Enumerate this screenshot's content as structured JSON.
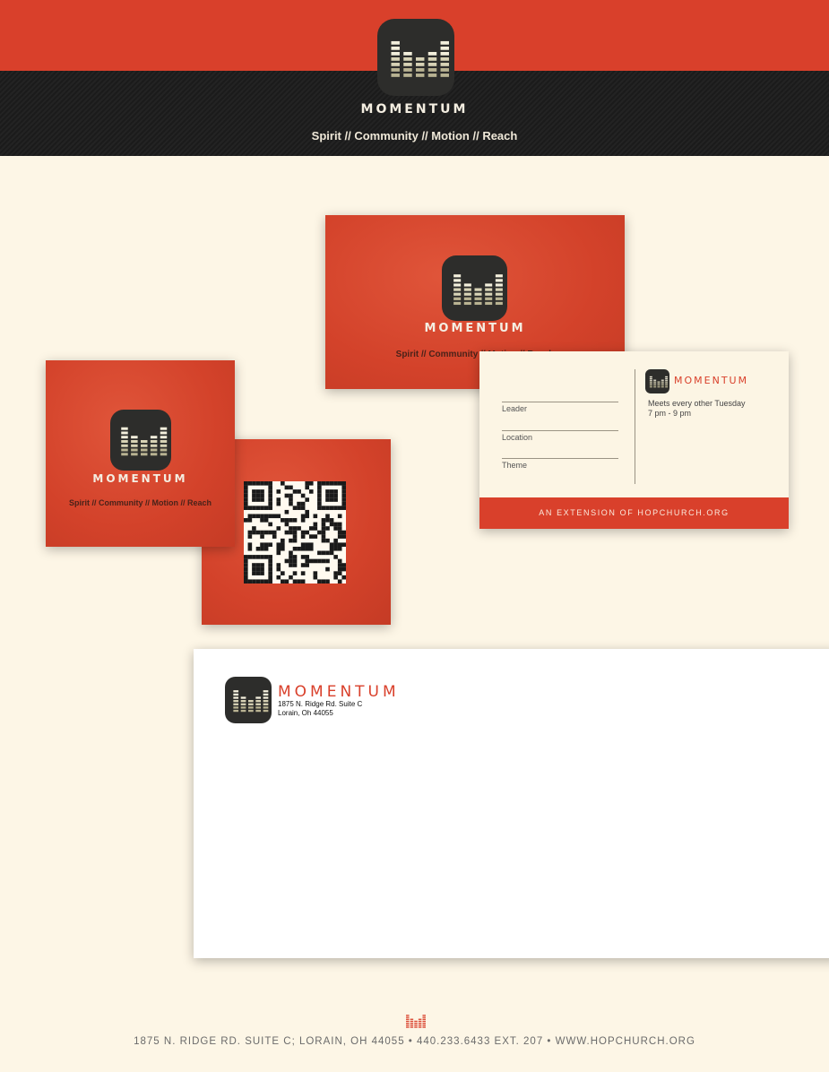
{
  "brand": {
    "name": "MOMENTUM",
    "tagline": "Spirit // Community // Motion // Reach",
    "logo_icon": "equalizer-m-icon",
    "colors": {
      "red": "#d9402b",
      "dark": "#2d2d2b",
      "cream": "#fdf6e6"
    }
  },
  "info_card": {
    "fields": [
      "Leader",
      "Location",
      "Theme"
    ],
    "meets_line1": "Meets every other Tuesday",
    "meets_line2": "7 pm - 9 pm",
    "footer": "AN EXTENSION OF HOPCHURCH.ORG"
  },
  "envelope": {
    "address_line1": "1875 N. Ridge Rd. Suite C",
    "address_line2": "Lorain, Oh 44055"
  },
  "footer": {
    "text": "1875 N. RIDGE RD. SUITE C; LORAIN, OH 44055 • 440.233.6433 EXT. 207 •  WWW.HOPCHURCH.ORG"
  }
}
